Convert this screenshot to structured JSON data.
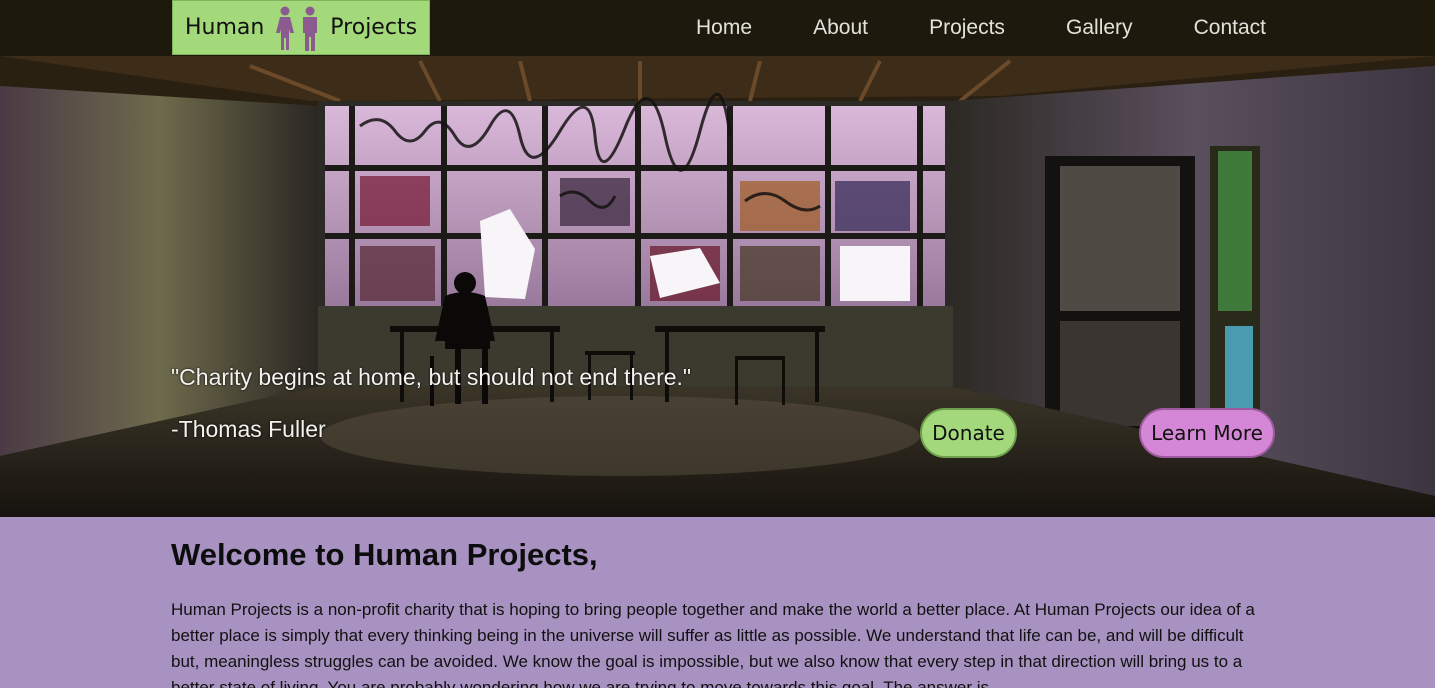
{
  "logo": {
    "word_left": "Human",
    "word_right": "Projects",
    "color": "#a3d97b",
    "icon": "people-icon"
  },
  "nav": {
    "items": [
      "Home",
      "About",
      "Projects",
      "Gallery",
      "Contact"
    ]
  },
  "hero": {
    "quote": "\"Charity begins at home, but should not end there.\"",
    "author": "-Thomas Fuller",
    "donate_label": "Donate",
    "learn_label": "Learn More",
    "donate_color": "#a3d97b",
    "learn_color": "#d487d6"
  },
  "content": {
    "heading": "Welcome to Human Projects,",
    "paragraph": "Human Projects is a non-profit charity that is hoping to bring people together and make the world a better place. At Human Projects our idea of a better place is simply that every thinking being in the universe will suffer as little as possible. We understand that life can be, and will be difficult but, meaningless struggles can be avoided. We know the goal is impossible, but we also know that every step in that direction will bring us to a better state of living. You are probably wondering how we are trying to move towards this goal. The answer is",
    "background": "#a892c1"
  }
}
